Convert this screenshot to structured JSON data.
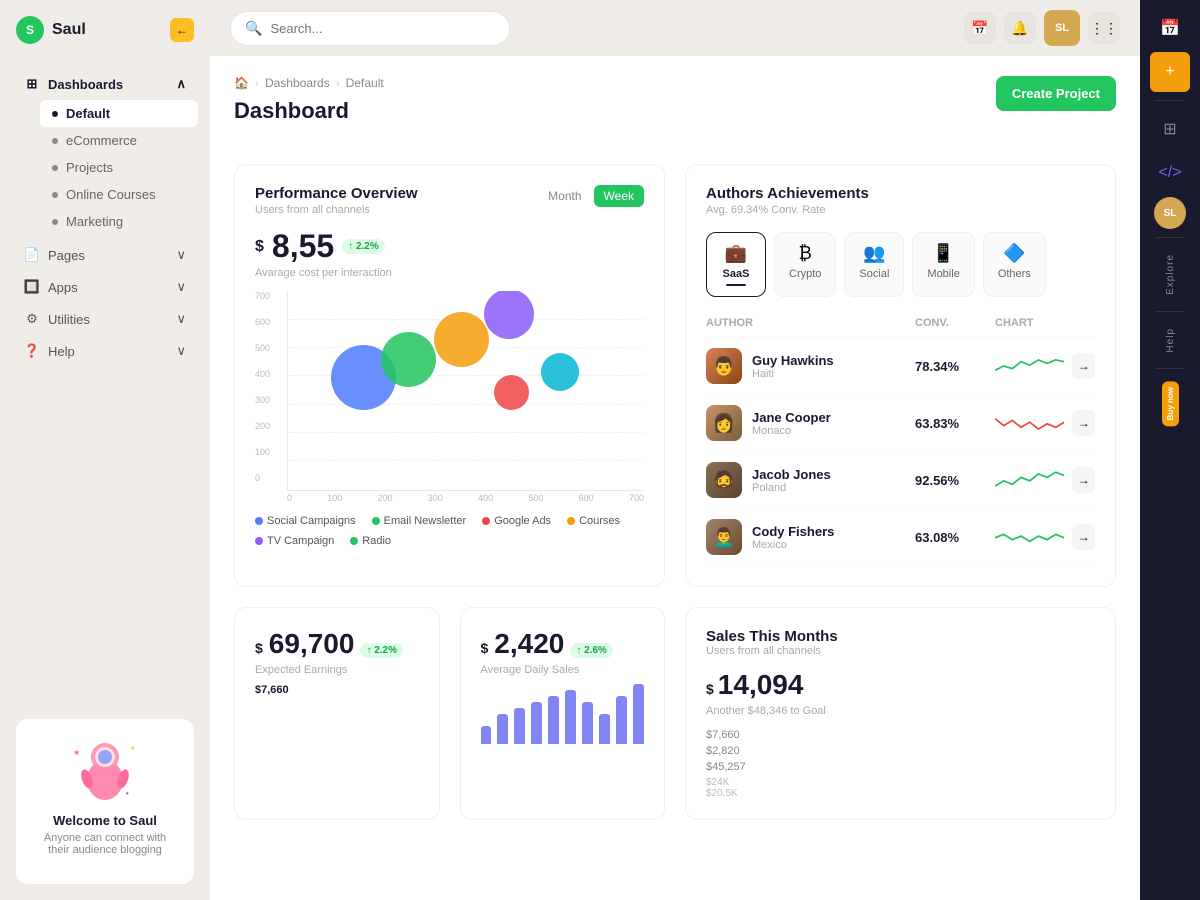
{
  "app": {
    "name": "Saul",
    "logo_letter": "S"
  },
  "topbar": {
    "search_placeholder": "Search...",
    "search_value": "Search _"
  },
  "sidebar": {
    "nav_items": [
      {
        "id": "dashboards",
        "label": "Dashboards",
        "has_arrow": true,
        "active": true
      },
      {
        "id": "ecommerce",
        "label": "eCommerce",
        "is_sub": true
      },
      {
        "id": "projects",
        "label": "Projects",
        "is_sub": true
      },
      {
        "id": "online-courses",
        "label": "Online Courses",
        "is_sub": true
      },
      {
        "id": "marketing",
        "label": "Marketing",
        "is_sub": true
      },
      {
        "id": "pages",
        "label": "Pages",
        "has_arrow": true
      },
      {
        "id": "apps",
        "label": "Apps",
        "has_arrow": true
      },
      {
        "id": "utilities",
        "label": "Utilities",
        "has_arrow": true
      },
      {
        "id": "help",
        "label": "Help",
        "has_arrow": true
      }
    ],
    "active_sub": "Default",
    "welcome": {
      "title": "Welcome to Saul",
      "subtitle": "Anyone can connect with their audience blogging"
    }
  },
  "breadcrumb": {
    "home": "🏠",
    "items": [
      "Dashboards",
      "Default"
    ]
  },
  "page": {
    "title": "Dashboard",
    "create_btn": "Create Project"
  },
  "performance": {
    "title": "Performance Overview",
    "subtitle": "Users from all channels",
    "tabs": [
      "Month",
      "Week"
    ],
    "active_tab": "Month",
    "metric": "8,55",
    "badge": "↑ 2.2%",
    "metric_label": "Avarage cost per interaction",
    "y_labels": [
      "700",
      "600",
      "500",
      "400",
      "300",
      "200",
      "100",
      "0"
    ],
    "x_labels": [
      "0",
      "100",
      "200",
      "300",
      "400",
      "500",
      "600",
      "700"
    ],
    "bubbles": [
      {
        "color": "#4f7bff",
        "size": 65,
        "x": 18,
        "y": 45,
        "label": "Social Campaigns"
      },
      {
        "color": "#22c55e",
        "size": 55,
        "x": 30,
        "y": 35,
        "label": "Email Newsletter"
      },
      {
        "color": "#f59e0b",
        "size": 55,
        "x": 42,
        "y": 25,
        "label": "Courses"
      },
      {
        "color": "#8b5cf6",
        "size": 50,
        "x": 55,
        "y": 15,
        "label": "TV Campaign"
      },
      {
        "color": "#ef4444",
        "size": 35,
        "x": 59,
        "y": 38,
        "label": "Google Ads"
      },
      {
        "color": "#06b6d4",
        "size": 38,
        "x": 72,
        "y": 32,
        "label": "Radio"
      }
    ],
    "legend": [
      {
        "color": "#4f7bff",
        "label": "Social Campaigns"
      },
      {
        "color": "#22c55e",
        "label": "Email Newsletter"
      },
      {
        "color": "#ef4444",
        "label": "Google Ads"
      },
      {
        "color": "#f59e0b",
        "label": "Courses"
      },
      {
        "color": "#8b5cf6",
        "label": "TV Campaign"
      },
      {
        "color": "#22c55e",
        "label": "Radio"
      }
    ]
  },
  "authors": {
    "title": "Authors Achievements",
    "subtitle": "Avg. 69.34% Conv. Rate",
    "categories": [
      {
        "id": "saas",
        "label": "SaaS",
        "icon": "💼",
        "active": true
      },
      {
        "id": "crypto",
        "label": "Crypto",
        "icon": "₿"
      },
      {
        "id": "social",
        "label": "Social",
        "icon": "👥"
      },
      {
        "id": "mobile",
        "label": "Mobile",
        "icon": "📱"
      },
      {
        "id": "others",
        "label": "Others",
        "icon": "🔷"
      }
    ],
    "columns": [
      "Author",
      "Conv.",
      "Chart"
    ],
    "rows": [
      {
        "name": "Guy Hawkins",
        "country": "Haiti",
        "conv": "78.34%",
        "chart_color": "#22c55e",
        "av_class": "av-guy"
      },
      {
        "name": "Jane Cooper",
        "country": "Monaco",
        "conv": "63.83%",
        "chart_color": "#ef4444",
        "av_class": "av-jane"
      },
      {
        "name": "Jacob Jones",
        "country": "Poland",
        "conv": "92.56%",
        "chart_color": "#22c55e",
        "av_class": "av-jacob"
      },
      {
        "name": "Cody Fishers",
        "country": "Mexico",
        "conv": "63.08%",
        "chart_color": "#22c55e",
        "av_class": "av-cody"
      }
    ]
  },
  "stats": [
    {
      "value": "69,700",
      "dollar": "$",
      "badge": "↑ 2.2%",
      "badge_color": "green",
      "label": "Expected Earnings"
    },
    {
      "value": "2,420",
      "dollar": "$",
      "badge": "↑ 2.6%",
      "badge_color": "green",
      "label": "Average Daily Sales"
    }
  ],
  "sales": {
    "title": "Sales This Months",
    "subtitle": "Users from all channels",
    "big_value": "14,094",
    "dollar": "$",
    "goal_text": "Another $48,346 to Goal",
    "bar_values": [
      3,
      5,
      6,
      7,
      8,
      9,
      7,
      5,
      8,
      10
    ],
    "amounts": [
      "$7,660",
      "$2,820",
      "$45,257"
    ]
  },
  "right_sidebar": {
    "labels": [
      "Explore",
      "Help",
      "Buy now"
    ]
  }
}
